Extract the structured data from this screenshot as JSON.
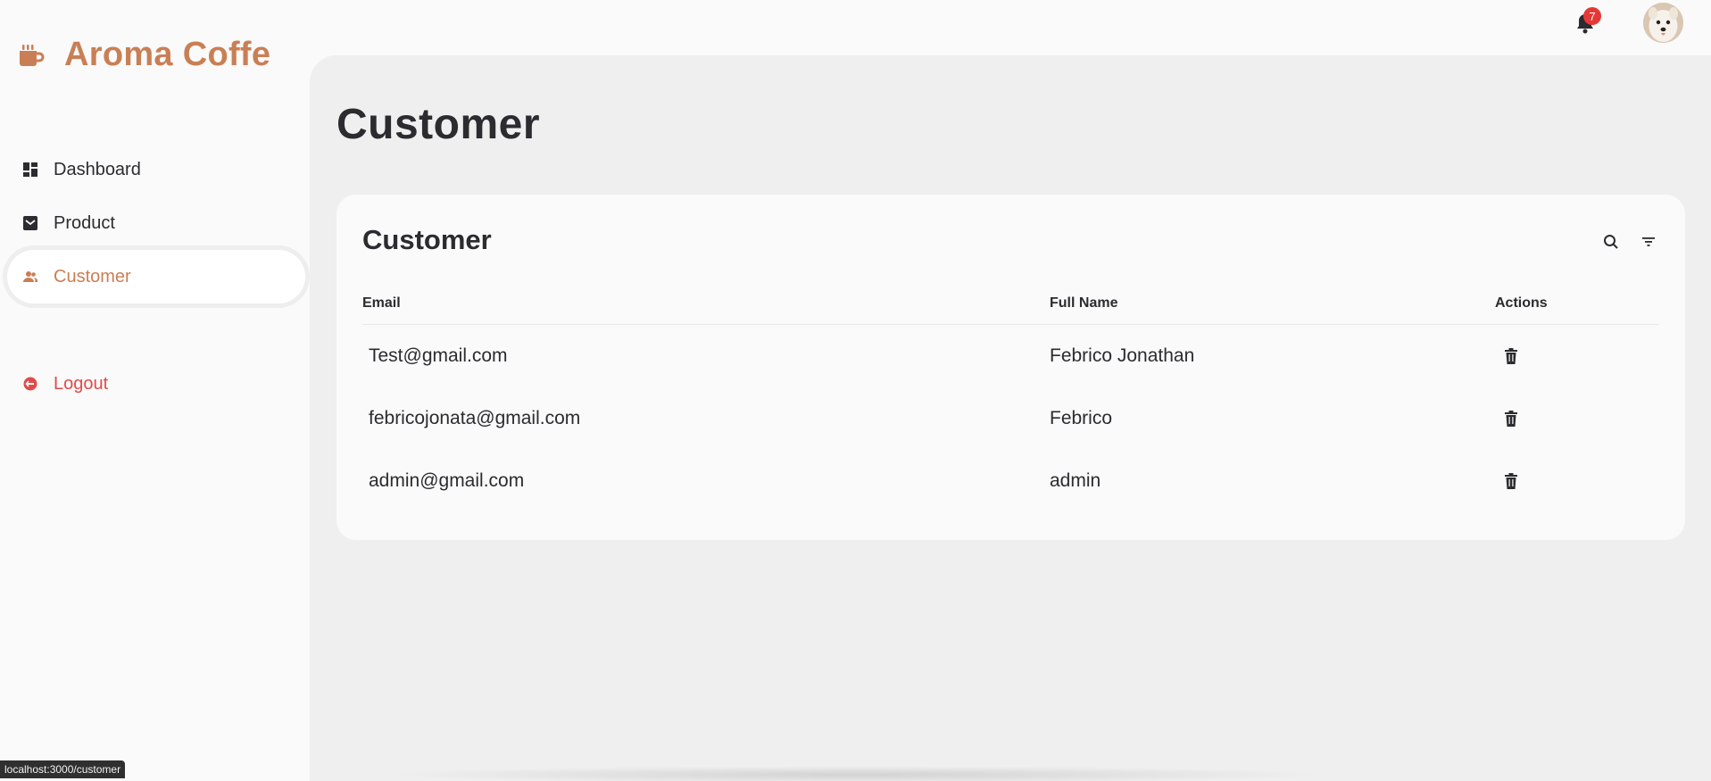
{
  "brand": {
    "name": "Aroma Coffe",
    "icon": "coffee-cup-icon",
    "color": "#c97f55"
  },
  "sidebar": {
    "items": [
      {
        "label": "Dashboard",
        "icon": "dashboard-icon"
      },
      {
        "label": "Product",
        "icon": "product-icon"
      },
      {
        "label": "Customer",
        "icon": "customer-icon",
        "active": true
      },
      {
        "label": "Logout",
        "icon": "logout-icon"
      }
    ]
  },
  "header": {
    "notification_count": "7"
  },
  "page": {
    "title": "Customer"
  },
  "card": {
    "title": "Customer",
    "columns": [
      "Email",
      "Full Name",
      "Actions"
    ],
    "rows": [
      {
        "email": "Test@gmail.com",
        "full_name": "Febrico Jonathan"
      },
      {
        "email": "febricojonata@gmail.com",
        "full_name": "Febrico"
      },
      {
        "email": "admin@gmail.com",
        "full_name": "admin"
      }
    ]
  },
  "statusbar": {
    "url": "localhost:3000/customer"
  },
  "colors": {
    "accent": "#c97f55",
    "danger": "#e14a4a",
    "badge": "#e53935"
  }
}
